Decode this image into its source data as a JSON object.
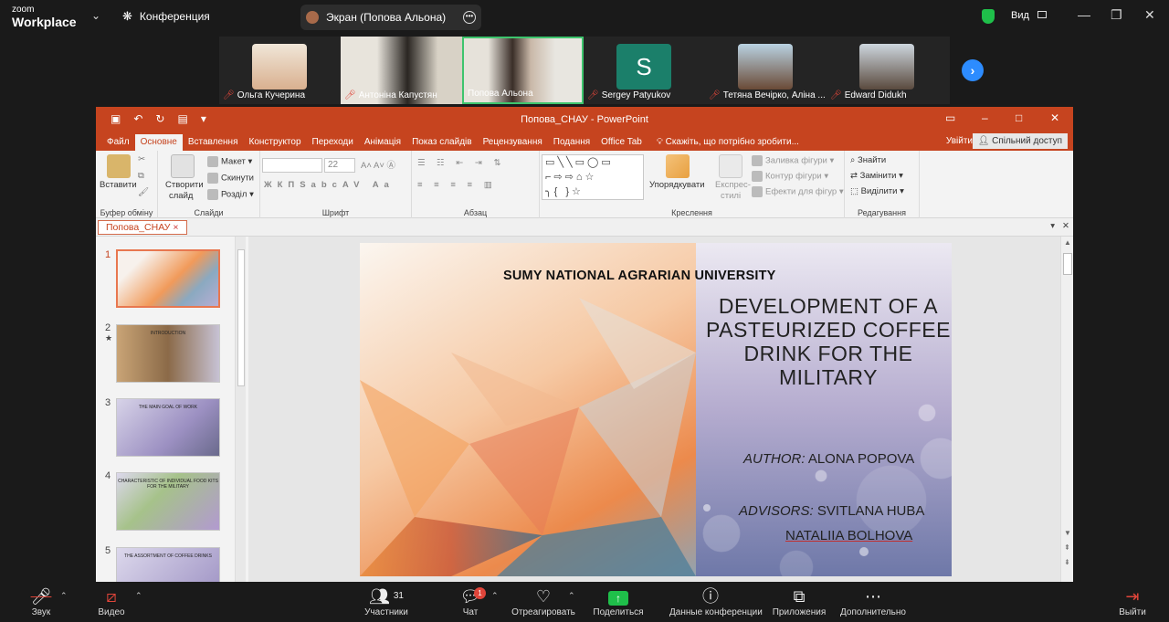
{
  "zoom": {
    "logo_small": "zoom",
    "logo_big": "Workplace",
    "conference_label": "Конференция",
    "screen_share_label": "Экран (Попова Альона)",
    "view_label": "Вид",
    "participants": [
      {
        "name": "Ольга Кучерина"
      },
      {
        "name": "Антоніна Капустян"
      },
      {
        "name": "Попова Альона"
      },
      {
        "name": "Sergey Patyukov",
        "initial": "S"
      },
      {
        "name": "Тетяна Вечірко, Аліна ..."
      },
      {
        "name": "Edward Didukh"
      }
    ],
    "bottom": {
      "audio": "Звук",
      "video": "Видео",
      "participants": "Участники",
      "participants_count": "31",
      "chat": "Чат",
      "chat_badge": "1",
      "react": "Отреагировать",
      "share": "Поделиться",
      "info": "Данные конференции",
      "apps": "Приложения",
      "more": "Дополнительно",
      "leave": "Выйти"
    }
  },
  "ppt": {
    "window_title": "Попова_СНАУ - PowerPoint",
    "tabs": [
      "Файл",
      "Основне",
      "Вставлення",
      "Конструктор",
      "Переходи",
      "Анімація",
      "Показ слайдів",
      "Рецензування",
      "Подання",
      "Office Tab"
    ],
    "tell_me": "Скажіть, що потрібно зробити...",
    "sign_in": "Увійти",
    "share": "Спільний доступ",
    "ribbon": {
      "paste": "Вставити",
      "clipboard": "Буфер обміну",
      "new_slide_1": "Створити",
      "new_slide_2": "слайд",
      "layout": "Макет",
      "reset": "Скинути",
      "section": "Розділ",
      "slides": "Слайди",
      "font_size": "22",
      "font": "Шрифт",
      "paragraph": "Абзац",
      "arrange": "Упорядкувати",
      "quick_styles_1": "Експрес-",
      "quick_styles_2": "стилі",
      "shape_fill": "Заливка фігури",
      "shape_outline": "Контур фігури",
      "shape_effects": "Ефекти для фігур",
      "drawing": "Креслення",
      "find": "Знайти",
      "replace": "Замінити",
      "select": "Виділити",
      "editing": "Редагування"
    },
    "doc_tab": "Попова_СНАУ",
    "thumbnails": [
      {
        "num": "1",
        "title": ""
      },
      {
        "num": "2",
        "title": "INTRODUCTION"
      },
      {
        "num": "3",
        "title": "THE MAIN GOAL OF WORK"
      },
      {
        "num": "4",
        "title": "CHARACTERISTIC OF INDIVIDUAL FOOD KITS FOR THE MILITARY"
      },
      {
        "num": "5",
        "title": "THE ASSORTMENT OF COFFEE DRINKS"
      }
    ],
    "slide": {
      "university": "SUMY NATIONAL AGRARIAN UNIVERSITY",
      "title": "DEVELOPMENT OF A PASTEURIZED COFFEE DRINK FOR THE MILITARY",
      "author_label": "AUTHOR:",
      "author_name": " ALONA POPOVA",
      "advisors_label": "ADVISORS:",
      "advisor_1": " SVITLANA HUBA",
      "advisor_2": "NATALIIA BOLHOVA"
    }
  }
}
